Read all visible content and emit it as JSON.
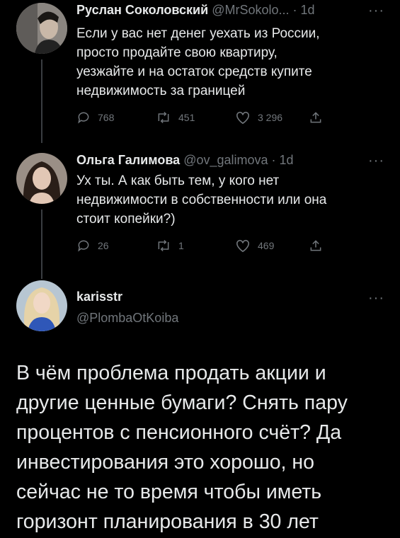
{
  "tweets": [
    {
      "name": "Руслан Соколовский",
      "handle_time": "@MrSokolo... · 1d",
      "lines": [
        "Если у вас нет денег уехать из России,",
        "просто продайте свою квартиру,",
        "уезжайте и на остаток средств купите",
        "недвижимость за границей"
      ],
      "replies": "768",
      "retweets": "451",
      "likes": "3 296"
    },
    {
      "name": "Ольга Галимова",
      "handle_time": "@ov_galimova · 1d",
      "lines": [
        "Ух ты. А как быть тем, у кого нет",
        "недвижимости в собственности или она",
        "стоит копейки?)"
      ],
      "replies": "26",
      "retweets": "1",
      "likes": "469"
    }
  ],
  "main_tweet": {
    "name": "karisstr",
    "handle": "@PlombaOtKoiba",
    "lines": [
      "В чём проблема продать акции и",
      "другие ценные бумаги? Снять пару",
      "процентов с пенсионного счёт? Да",
      "инвестирования это хорошо, но",
      "сейчас не то время чтобы иметь",
      "горизонт планирования в 30 лет"
    ]
  },
  "more_label": "···",
  "icons": [
    "reply-icon",
    "retweet-icon",
    "like-icon",
    "share-icon",
    "more-icon"
  ],
  "colors": {
    "background": "#000000",
    "text": "#e7e9ea",
    "secondary": "#71767b",
    "thread_line": "#3a3d41"
  }
}
